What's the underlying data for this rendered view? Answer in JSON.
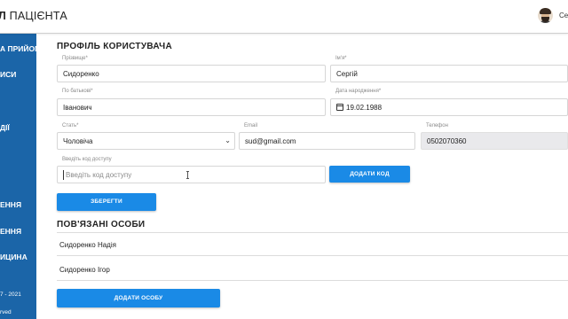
{
  "header": {
    "brand_prefix": "Л",
    "brand_rest": " ПАЦІЄНТА",
    "user_name": "Сер"
  },
  "sidebar": {
    "items": [
      {
        "label": "А ПРИЙОМ"
      },
      {
        "label": "ИСИ"
      },
      {
        "label": "ДІЇ"
      },
      {
        "label": "ЕННЯ"
      },
      {
        "label": "ЕННЯ"
      },
      {
        "label": "ИЦИНА"
      }
    ],
    "footer_years": "7 - 2021",
    "footer_rights": "rved"
  },
  "profile": {
    "title": "ПРОФІЛЬ КОРИСТУВАЧА",
    "fields": {
      "surname": {
        "label": "Прізвище*",
        "value": "Сидоренко"
      },
      "name": {
        "label": "Ім'я*",
        "value": "Сергій"
      },
      "patronymic": {
        "label": "По батькові*",
        "value": "Іванович"
      },
      "birthdate": {
        "label": "Дата народження*",
        "value": "19.02.1988"
      },
      "gender": {
        "label": "Стать*",
        "value": "Чоловіча"
      },
      "email": {
        "label": "Email",
        "value": "sud@gmail.com"
      },
      "phone": {
        "label": "Телефон",
        "value": "0502070360"
      },
      "access_code": {
        "label": "Введіть код доступу",
        "placeholder": "Введіть код доступу"
      }
    },
    "add_code_button": "ДОДАТИ КОД",
    "save_button": "ЗБЕРЕГТИ"
  },
  "related": {
    "title": "ПОВ'ЯЗАНІ ОСОБИ",
    "people": [
      "Сидоренко Надія",
      "Сидоренко Ігор"
    ],
    "add_button": "ДОДАТИ ОСОБУ"
  },
  "colors": {
    "sidebar": "#1b65a8",
    "accent_button": "#1a8ae6"
  }
}
